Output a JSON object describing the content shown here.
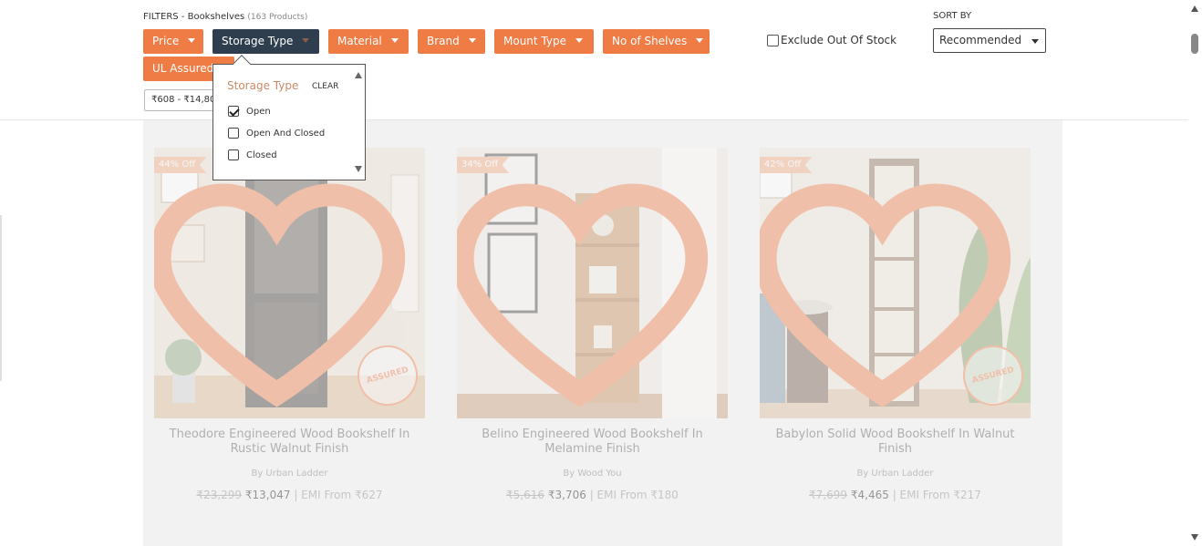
{
  "filters": {
    "heading": "FILTERS - Bookshelves",
    "count": "(163 Products)",
    "chips": {
      "price": "Price",
      "storage_type": "Storage Type",
      "material": "Material",
      "brand": "Brand",
      "mount_type": "Mount Type",
      "no_of_shelves": "No of Shelves",
      "ul_assured": "UL Assured"
    },
    "price_tag": "₹608 - ₹14,801",
    "exclude_out_of_stock": "Exclude Out Of Stock",
    "accent_color": "#ef7b45",
    "active_color": "#2e3e4f"
  },
  "sort": {
    "label": "SORT BY",
    "selected": "Recommended"
  },
  "storage_dropdown": {
    "title": "Storage Type",
    "clear": "CLEAR",
    "options": [
      {
        "label": "Open",
        "checked": true
      },
      {
        "label": "Open And Closed",
        "checked": false
      },
      {
        "label": "Closed",
        "checked": false
      }
    ]
  },
  "products": [
    {
      "discount": "44% Off",
      "name": "Theodore Engineered Wood Bookshelf In Rustic Walnut Finish",
      "brand": "By Urban Ladder",
      "mrp": "₹23,299",
      "price": "₹13,047",
      "emi": "| EMI From ₹627",
      "assured_badge": "ASSURED"
    },
    {
      "discount": "34% Off",
      "name": "Belino Engineered Wood Bookshelf In Melamine Finish",
      "brand": "By Wood You",
      "mrp": "₹5,616",
      "price": "₹3,706",
      "emi": "| EMI From ₹180",
      "assured_badge": ""
    },
    {
      "discount": "42% Off",
      "name": "Babylon Solid Wood Bookshelf In Walnut Finish",
      "brand": "By Urban Ladder",
      "mrp": "₹7,699",
      "price": "₹4,465",
      "emi": "| EMI From ₹217",
      "assured_badge": "ASSURED"
    }
  ]
}
